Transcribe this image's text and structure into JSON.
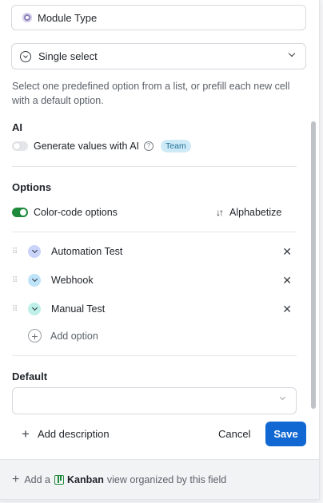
{
  "field": {
    "name": "Module Type",
    "icon": "gear-icon"
  },
  "type_select": {
    "value": "Single select",
    "icon": "chevron-circle-icon"
  },
  "description": "Select one predefined option from a list, or prefill each new cell with a default option.",
  "ai": {
    "title": "AI",
    "toggle_label": "Generate values with AI",
    "enabled": false,
    "badge": "Team"
  },
  "options": {
    "title": "Options",
    "color_code_label": "Color-code options",
    "color_code_enabled": true,
    "alphabetize_label": "Alphabetize",
    "items": [
      {
        "label": "Automation Test",
        "color": "#c9d4fb"
      },
      {
        "label": "Webhook",
        "color": "#bfe3f9"
      },
      {
        "label": "Manual Test",
        "color": "#bff0e7"
      }
    ],
    "add_label": "Add option"
  },
  "default": {
    "title": "Default",
    "value": ""
  },
  "actions": {
    "add_description": "Add description",
    "cancel": "Cancel",
    "save": "Save"
  },
  "bottom": {
    "prefix": "Add a",
    "view_name": "Kanban",
    "suffix": "view organized by this field"
  },
  "colors": {
    "primary": "#1268d3",
    "toggle_on": "#1f8a3b",
    "badge_bg": "#cfeaf7"
  }
}
